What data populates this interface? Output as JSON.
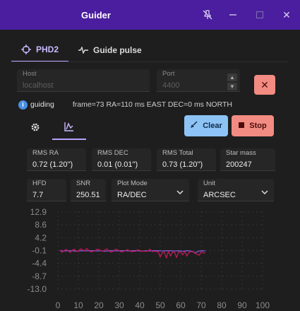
{
  "window": {
    "title": "Guider",
    "close_symbol": "✕"
  },
  "tabs": [
    {
      "label": "PHD2",
      "icon": "crosshair-icon"
    },
    {
      "label": "Guide pulse",
      "icon": "pulse-icon"
    }
  ],
  "connection": {
    "host_label": "Host",
    "host_value": "localhost",
    "port_label": "Port",
    "port_value": "4400",
    "disconnect_symbol": "✕"
  },
  "status": {
    "info": "i",
    "state": "guiding",
    "detail": "frame=73 RA=110 ms EAST DEC=0 ms NORTH"
  },
  "actions": {
    "clear_label": "Clear",
    "stop_label": "Stop"
  },
  "stats": {
    "rms_ra_label": "RMS RA",
    "rms_ra": "0.72 (1.20\")",
    "rms_dec_label": "RMS DEC",
    "rms_dec": "0.01 (0.01\")",
    "rms_total_label": "RMS Total",
    "rms_total": "0.73 (1.20\")",
    "star_mass_label": "Star mass",
    "star_mass": "200247",
    "hfd_label": "HFD",
    "hfd": "7.7",
    "snr_label": "SNR",
    "snr": "250.51",
    "plot_mode_label": "Plot Mode",
    "plot_mode": "RA/DEC",
    "unit_label": "Unit",
    "unit": "ARCSEC"
  },
  "colors": {
    "ra": "#7a5cd6",
    "dec": "#c2185b",
    "accent": "#b7a2ff"
  },
  "chart_data": {
    "type": "line",
    "y_ticks": [
      "12.9",
      "8.6",
      "4.2",
      "-0.1",
      "-4.4",
      "-8.7",
      "-13.0"
    ],
    "x_ticks": [
      "0",
      "10",
      "20",
      "30",
      "40",
      "50",
      "60",
      "70",
      "80",
      "90",
      "100"
    ],
    "xlim": [
      0,
      100
    ],
    "ylim": [
      -13.0,
      12.9
    ],
    "grid": true,
    "series": [
      {
        "color": "#7a5cd6",
        "x": [
          1,
          3,
          5,
          7,
          9,
          11,
          13,
          15,
          17,
          19,
          21,
          23,
          25,
          27,
          29,
          31,
          33,
          35,
          37,
          39,
          41,
          43,
          45,
          47,
          49,
          51,
          53,
          55,
          57,
          59,
          61,
          63,
          65,
          67,
          69,
          71,
          72
        ],
        "y": [
          -0.1,
          -0.2,
          -0.1,
          -0.1,
          -0.3,
          -0.1,
          -0.2,
          -0.1,
          -0.1,
          -0.2,
          -0.1,
          -0.3,
          -0.1,
          -0.1,
          -0.2,
          -0.1,
          -0.1,
          -0.2,
          -0.1,
          -0.1,
          -0.3,
          -0.1,
          -0.2,
          -0.1,
          -0.1,
          -0.2,
          -0.1,
          -0.1,
          -0.2,
          -0.1,
          -0.3,
          -0.1,
          -0.2,
          -0.8,
          -0.2,
          -0.1,
          -0.2
        ]
      },
      {
        "color": "#c2185b",
        "x": [
          1,
          2,
          3,
          4,
          5,
          6,
          7,
          8,
          9,
          10,
          11,
          12,
          13,
          14,
          15,
          16,
          17,
          18,
          19,
          20,
          21,
          22,
          23,
          24,
          25,
          26,
          27,
          28,
          29,
          30,
          31,
          32,
          33,
          34,
          35,
          36,
          37,
          38,
          39,
          40,
          41,
          42,
          43,
          44,
          45,
          46,
          47,
          48,
          49,
          50,
          51,
          52,
          53,
          54,
          55,
          56,
          57,
          58,
          59,
          60,
          61,
          62,
          63,
          64,
          65,
          66,
          67,
          68,
          69,
          70,
          71,
          72
        ],
        "y": [
          0.2,
          -0.6,
          -0.1,
          0.3,
          -0.1,
          -0.7,
          0.0,
          0.4,
          -0.2,
          -0.4,
          0.5,
          0.3,
          -0.2,
          0.6,
          0.1,
          -0.5,
          -0.3,
          -0.2,
          0.4,
          0.3,
          -0.1,
          -0.3,
          0.2,
          0.5,
          -0.2,
          -0.6,
          -0.3,
          0.4,
          0.3,
          -0.2,
          -0.5,
          -0.3,
          -0.1,
          0.3,
          -0.2,
          -0.4,
          -0.3,
          -0.3,
          0.2,
          -0.1,
          -0.2,
          -0.3,
          -0.3,
          -0.2,
          0.4,
          -0.4,
          -0.3,
          -0.3,
          -0.5,
          -2.2,
          -0.8,
          -0.5,
          -2.6,
          -0.2,
          -1.9,
          -0.6,
          -0.6,
          -2.4,
          -0.5,
          -0.6,
          -1.5,
          -0.3,
          -1.9,
          -0.7,
          -0.4,
          -0.3,
          -1.0,
          -1.3,
          -1.6,
          -0.5,
          -0.8,
          -0.9
        ]
      }
    ]
  }
}
